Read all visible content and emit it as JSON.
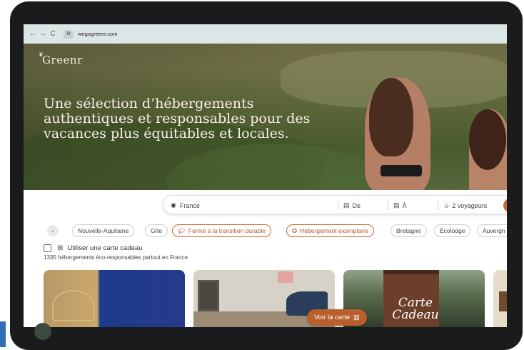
{
  "browser": {
    "url": "wegogreenr.com",
    "back_icon": "←",
    "forward_icon": "→",
    "reload_icon": "C",
    "site_icon": "⚙"
  },
  "hero": {
    "logo": "Greenr",
    "headline": "Une sélection d’hébergements authentiques et responsables pour des vacances plus équitables et locales."
  },
  "search": {
    "destination": "France",
    "date_from": "De",
    "date_to": "À",
    "guests": "2 voyageurs"
  },
  "filters": [
    "Nouvelle-Aquitaine",
    "Gîte",
    "Formé à la transition durable",
    "Hébergement exemplaire",
    "Bretagne",
    "Écolodge",
    "Auvergn"
  ],
  "gift_card_label": "Utiliser une carte cadeau",
  "result_count": "1335 hébergements éco-responsables partout en France",
  "cards": {
    "card3_overlay": "Carte Cadeau"
  },
  "map_button": "Voir la carte",
  "colors": {
    "accent": "#c9692f",
    "browser_bar": "#dde6e6",
    "device": "#1a1b1d"
  }
}
